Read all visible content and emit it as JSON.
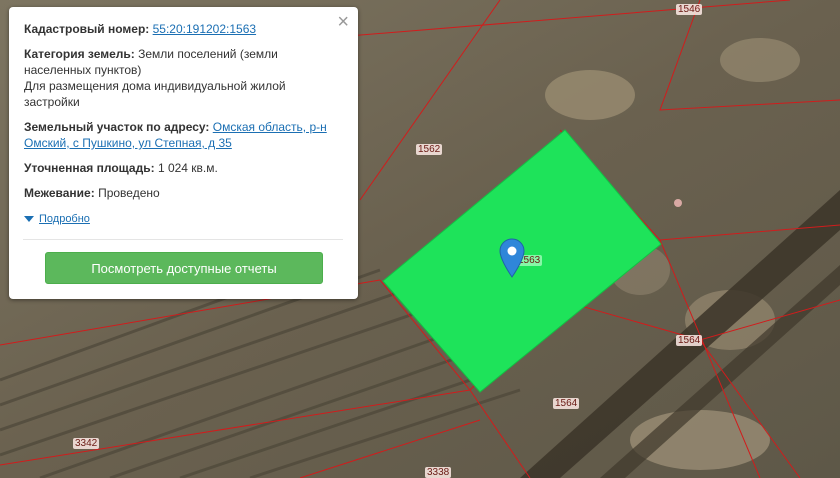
{
  "popup": {
    "cadastral_label": "Кадастровый номер:",
    "cadastral_value": "55:20:191202:1563",
    "category_label": "Категория земель:",
    "category_value": "Земли поселений (земли населенных пунктов)",
    "purpose": "Для размещения дома индивидуальной жилой застройки",
    "address_label": "Земельный участок по адресу:",
    "address_value": "Омская область, р-н Омский, с Пушкино, ул Степная, д 35",
    "area_label": "Уточненная площадь:",
    "area_value": "1 024 кв.м.",
    "survey_label": "Межевание:",
    "survey_value": "Проведено",
    "more_link": "Подробно",
    "report_button": "Посмотреть доступные отчеты",
    "close_symbol": "×"
  },
  "map": {
    "plot_labels": [
      "1546",
      "1562",
      "1563",
      "1564",
      "1564",
      "3342",
      "3338"
    ],
    "colors": {
      "selected_parcel": "#1ee35a",
      "boundary": "#d11c1c",
      "marker": "#2f86d9"
    }
  }
}
